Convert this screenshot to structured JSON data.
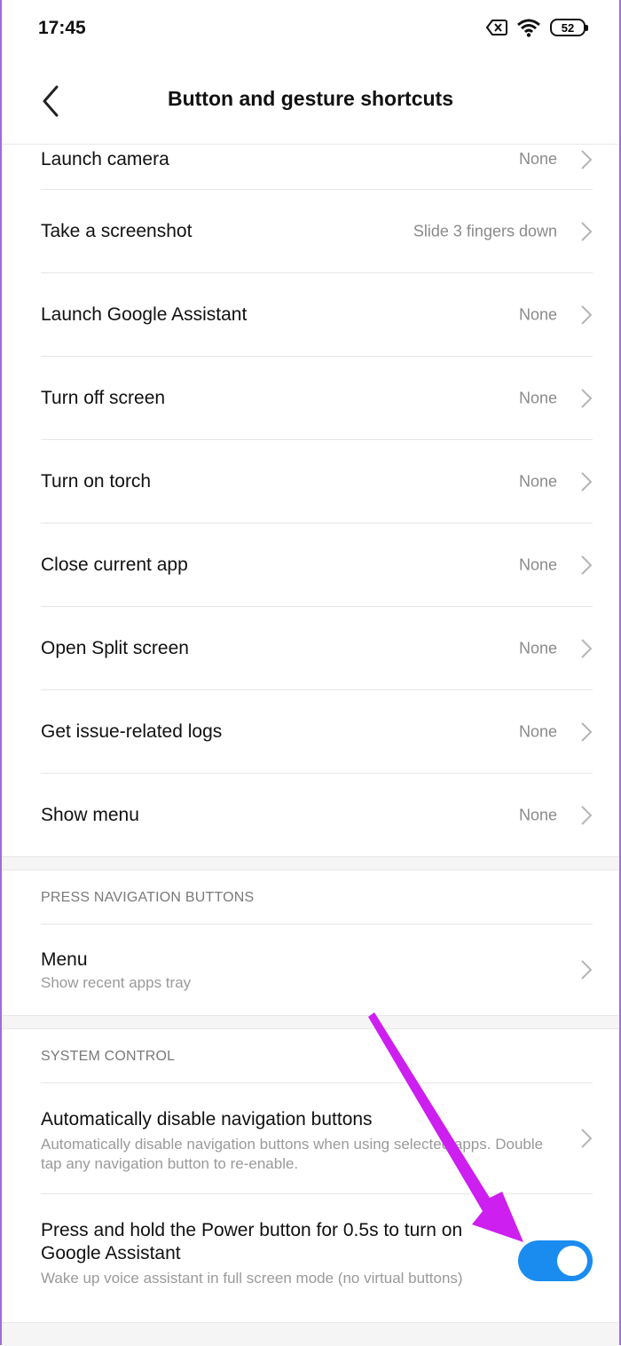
{
  "status": {
    "time": "17:45",
    "battery": "52"
  },
  "header": {
    "title": "Button and gesture shortcuts"
  },
  "shortcuts": [
    {
      "label": "Launch camera",
      "value": "None"
    },
    {
      "label": "Take a screenshot",
      "value": "Slide 3 fingers down"
    },
    {
      "label": "Launch Google Assistant",
      "value": "None"
    },
    {
      "label": "Turn off screen",
      "value": "None"
    },
    {
      "label": "Turn on torch",
      "value": "None"
    },
    {
      "label": "Close current app",
      "value": "None"
    },
    {
      "label": "Open Split screen",
      "value": "None"
    },
    {
      "label": "Get issue-related logs",
      "value": "None"
    },
    {
      "label": "Show menu",
      "value": "None"
    }
  ],
  "nav_section": {
    "header": "PRESS NAVIGATION BUTTONS",
    "menu": {
      "title": "Menu",
      "subtitle": "Show recent apps tray"
    }
  },
  "system_section": {
    "header": "SYSTEM CONTROL",
    "auto_disable": {
      "title": "Automatically disable navigation buttons",
      "subtitle": "Automatically disable navigation buttons when using selected apps. Double tap any navigation button to re-enable."
    },
    "power_hold": {
      "title": "Press and hold the Power button for 0.5s to turn on Google Assistant",
      "subtitle": "Wake up voice assistant in full screen mode (no virtual buttons)",
      "enabled": true
    }
  },
  "colors": {
    "accent": "#1a8cf0",
    "annotation_arrow": "#cc1ff0"
  },
  "icons": [
    "wifi-icon",
    "sim-off-icon",
    "battery-icon",
    "back-arrow-icon",
    "chevron-right-icon"
  ]
}
